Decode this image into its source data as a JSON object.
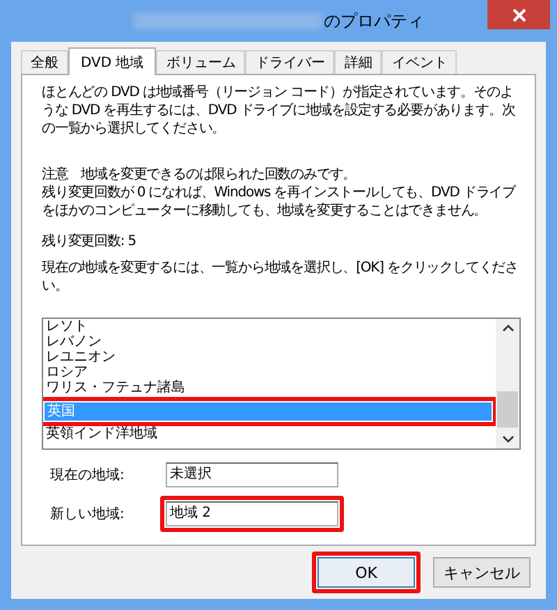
{
  "window": {
    "title": "のプロパティ",
    "title_redacted": true
  },
  "tabs": [
    {
      "label": "全般",
      "selected": false
    },
    {
      "label": "DVD 地域",
      "selected": true
    },
    {
      "label": "ボリューム",
      "selected": false
    },
    {
      "label": "ドライバー",
      "selected": false
    },
    {
      "label": "詳細",
      "selected": false
    },
    {
      "label": "イベント",
      "selected": false
    }
  ],
  "paragraphs": [
    "ほとんどの DVD は地域番号（リージョン コード）が指定されています。そのような DVD を再生するには、DVD ドライブに地域を設定する必要があります。次の一覧から選択してください。",
    "注意　地域を変更できるのは限られた回数のみです。",
    "残り変更回数が 0 になれば、Windows を再インストールしても、DVD ドライブをほかのコンピューターに移動しても、地域を変更することはできません。",
    "残り変更回数: 5",
    "現在の地域を変更するには、一覧から地域を選択し、[OK] をクリックしてください。"
  ],
  "region_list": [
    {
      "label": "レソト",
      "selected": false,
      "highlighted": false
    },
    {
      "label": "レバノン",
      "selected": false,
      "highlighted": false
    },
    {
      "label": "レユニオン",
      "selected": false,
      "highlighted": false
    },
    {
      "label": "ロシア",
      "selected": false,
      "highlighted": false
    },
    {
      "label": "ワリス・フテュナ諸島",
      "selected": false,
      "highlighted": false
    },
    {
      "label": "英国",
      "selected": true,
      "highlighted": true
    },
    {
      "label": "英領インド洋地域",
      "selected": false,
      "highlighted": false
    }
  ],
  "fields": [
    {
      "label": "現在の地域:",
      "value": "未選択",
      "highlighted": false
    },
    {
      "label": "新しい地域:",
      "value": "地域 2",
      "highlighted": true
    }
  ],
  "buttons": [
    {
      "label": "OK",
      "default": true,
      "highlighted": true
    },
    {
      "label": "キャンセル",
      "default": false,
      "highlighted": false
    }
  ]
}
